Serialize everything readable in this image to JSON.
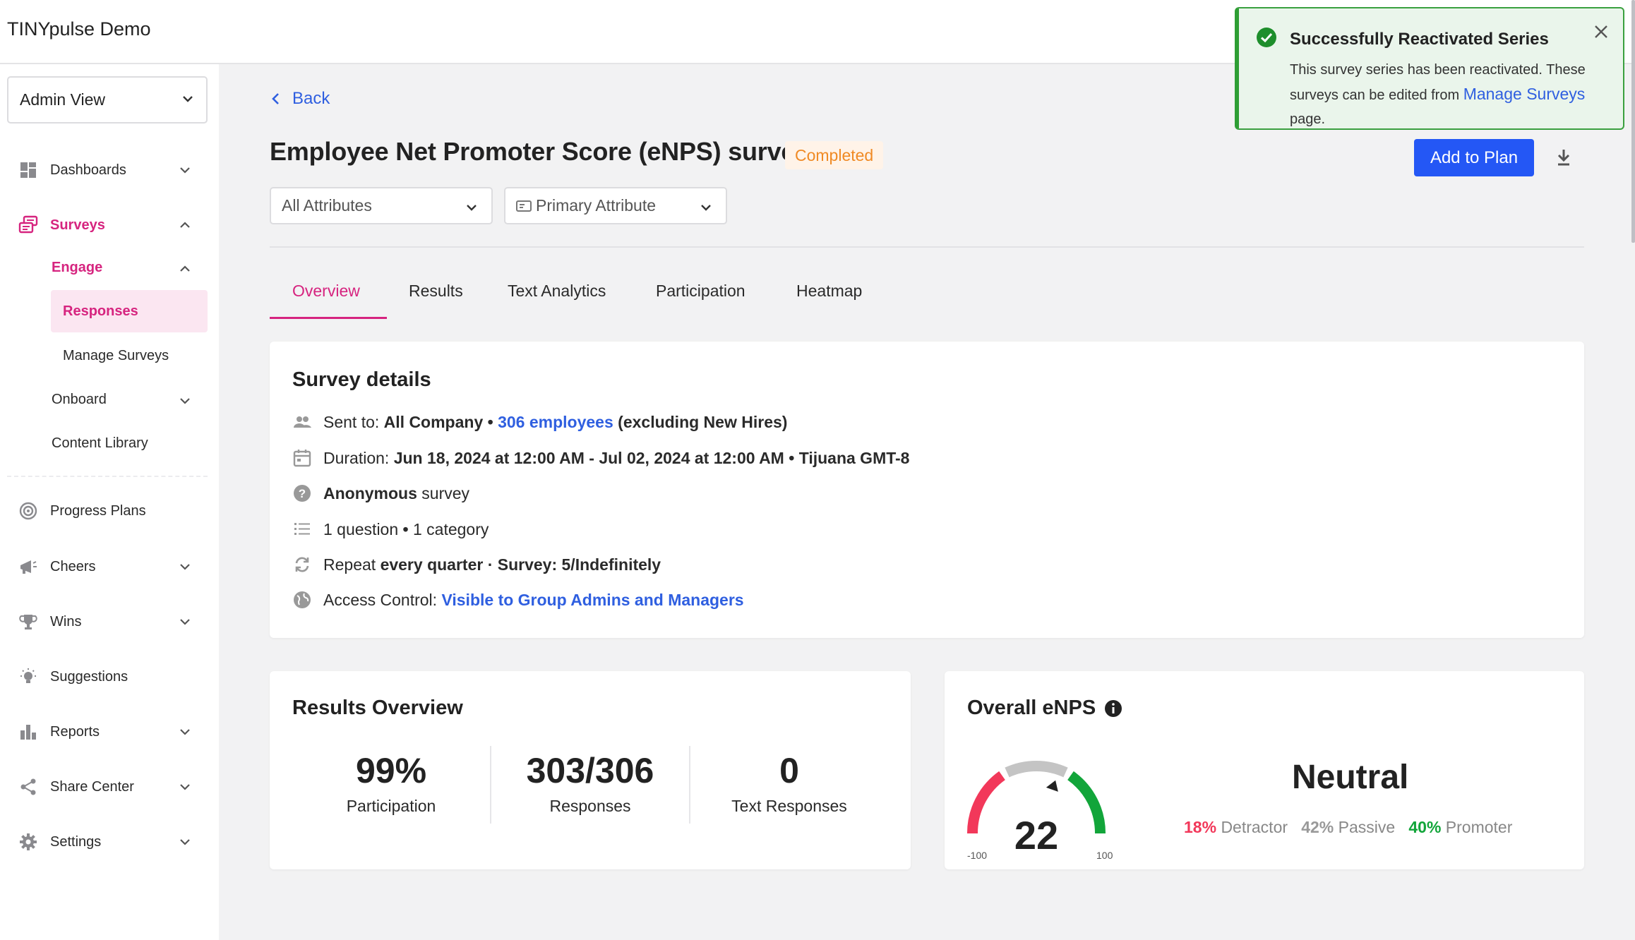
{
  "app": {
    "title": "TINYpulse Demo"
  },
  "sidebar": {
    "view_select": "Admin View",
    "items": [
      {
        "label": "Dashboards",
        "icon": "dashboard-icon"
      },
      {
        "label": "Surveys",
        "icon": "survey-icon"
      },
      {
        "label": "Progress Plans",
        "icon": "target-icon"
      },
      {
        "label": "Cheers",
        "icon": "megaphone-icon"
      },
      {
        "label": "Wins",
        "icon": "trophy-icon"
      },
      {
        "label": "Suggestions",
        "icon": "lightbulb-icon"
      },
      {
        "label": "Reports",
        "icon": "bar-chart-icon"
      },
      {
        "label": "Share Center",
        "icon": "share-icon"
      },
      {
        "label": "Settings",
        "icon": "gear-icon"
      }
    ],
    "engage": "Engage",
    "responses": "Responses",
    "manage_surveys": "Manage Surveys",
    "onboard": "Onboard",
    "content_library": "Content Library"
  },
  "main": {
    "back": "Back",
    "title": "Employee Net Promoter Score (eNPS) survey",
    "status": "Completed",
    "filters": {
      "attributes": "All Attributes",
      "primary": "Primary Attribute"
    },
    "add_to_plan": "Add to Plan",
    "tabs": [
      "Overview",
      "Results",
      "Text Analytics",
      "Participation",
      "Heatmap"
    ]
  },
  "survey_details": {
    "title": "Survey details",
    "sent_to_label": "Sent to:",
    "sent_to_value": "All Company",
    "sep": "•",
    "employees_link": "306 employees",
    "excluding": "(excluding New Hires)",
    "duration_label": "Duration:",
    "duration_value": "Jun 18, 2024 at 12:00 AM - Jul 02, 2024 at 12:00 AM",
    "timezone": "Tijuana GMT-8",
    "anonymous_bold": "Anonymous",
    "anonymous_rest": "survey",
    "questions": "1 question",
    "category": "1 category",
    "repeat_label": "Repeat",
    "repeat_value": "every quarter · Survey: 5/Indefinitely",
    "access_label": "Access Control:",
    "access_link": "Visible to Group Admins and Managers"
  },
  "results_overview": {
    "title": "Results Overview",
    "stats": [
      {
        "value": "99%",
        "label": "Participation"
      },
      {
        "value": "303/306",
        "label": "Responses"
      },
      {
        "value": "0",
        "label": "Text Responses"
      }
    ]
  },
  "enps": {
    "title": "Overall eNPS",
    "score": "22",
    "score_value": 22,
    "min_label": "-100",
    "max_label": "100",
    "rating": "Neutral",
    "detractor_pct": "18%",
    "detractor_label": "Detractor",
    "passive_pct": "42%",
    "passive_label": "Passive",
    "promoter_pct": "40%",
    "promoter_label": "Promoter",
    "colors": {
      "detractor": "#f2385a",
      "passive": "#b8b8b8",
      "promoter": "#12a53a"
    }
  },
  "toast": {
    "title": "Successfully Reactivated Series",
    "body_1": "This survey series has been reactivated. These surveys can be edited from",
    "body_link": "Manage Surveys",
    "body_2": "page."
  },
  "colors": {
    "accent": "#d6247f",
    "primary_button": "#2457f5",
    "link": "#2f5fe0",
    "success": "#2e9e34"
  }
}
